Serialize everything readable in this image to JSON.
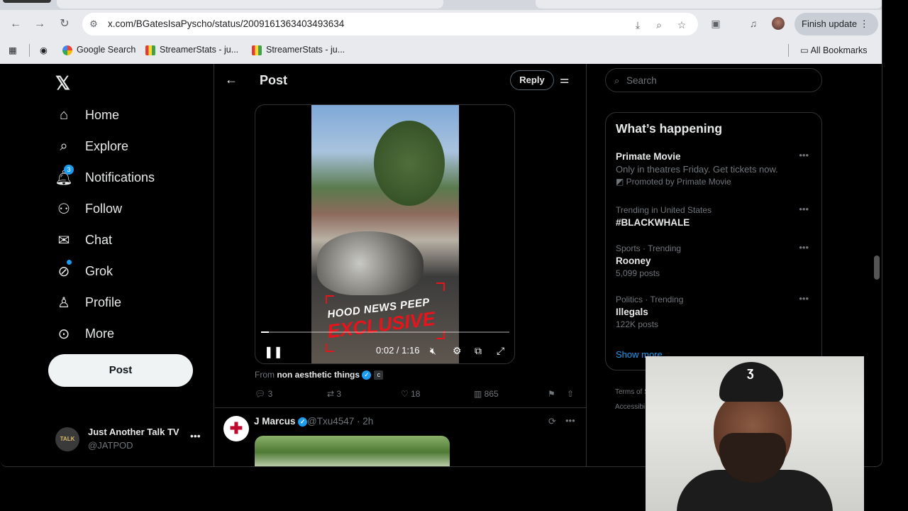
{
  "browser": {
    "url": "x.com/BGatesIsaPyscho/status/2009161363403493634",
    "finish_update_label": "Finish update",
    "bookmarks": [
      {
        "label": "Google Search"
      },
      {
        "label": "StreamerStats - ju..."
      },
      {
        "label": "StreamerStats - ju..."
      }
    ],
    "all_bookmarks_label": "All Bookmarks"
  },
  "sidebar": {
    "items": [
      {
        "label": "Home",
        "icon": "home-icon"
      },
      {
        "label": "Explore",
        "icon": "search-icon"
      },
      {
        "label": "Notifications",
        "icon": "bell-icon",
        "badge": "3"
      },
      {
        "label": "Follow",
        "icon": "add-person-icon"
      },
      {
        "label": "Chat",
        "icon": "mail-icon"
      },
      {
        "label": "Grok",
        "icon": "grok-icon"
      },
      {
        "label": "Profile",
        "icon": "person-icon"
      },
      {
        "label": "More",
        "icon": "more-circle-icon"
      }
    ],
    "post_button_label": "Post",
    "account": {
      "name": "Just Another Talk TV",
      "handle": "@JATPOD",
      "avatar_text": "TALK"
    }
  },
  "main": {
    "header_title": "Post",
    "reply_label": "Reply",
    "video": {
      "overlay_line1": "HOOD NEWS PEEP",
      "overlay_line2": "EXCLUSIVE",
      "time": "0:02 / 1:16",
      "progress": 0.03
    },
    "from_prefix": "From",
    "from_source": "non aesthetic things",
    "actions": {
      "replies": "3",
      "reposts": "3",
      "likes": "18",
      "views": "865"
    },
    "reply_post": {
      "name": "J Marcus",
      "handle_time": "@Txu4547 · 2h"
    }
  },
  "right": {
    "search_placeholder": "Search",
    "happening_title": "What’s happening",
    "trends": [
      {
        "title": "Primate Movie",
        "desc": "Only in theatres Friday. Get tickets now.",
        "promoted": "Promoted by Primate Movie"
      },
      {
        "meta": "Trending in United States",
        "title": "#BLACKWHALE"
      },
      {
        "meta": "Sports · Trending",
        "title": "Rooney",
        "sub": "5,099 posts"
      },
      {
        "meta": "Politics · Trending",
        "title": "Illegals",
        "sub": "122K posts"
      }
    ],
    "show_more": "Show more",
    "footer_1": "Terms of S",
    "footer_2": "Accessibi"
  },
  "colors": {
    "accent": "#1d9bf0",
    "background": "#000000",
    "text": "#e7e9ea",
    "muted": "#71767b",
    "exclusive_red": "#e8141b"
  }
}
